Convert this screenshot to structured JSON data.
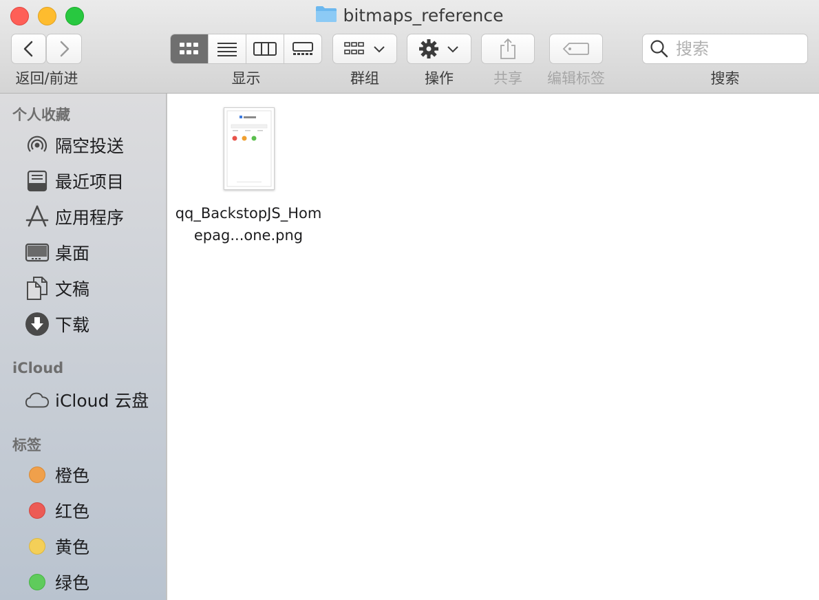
{
  "window": {
    "title": "bitmaps_reference"
  },
  "toolbar": {
    "nav_label": "返回/前进",
    "view_label": "显示",
    "group_label": "群组",
    "action_label": "操作",
    "share_label": "共享",
    "tags_label": "编辑标签",
    "search_label": "搜索",
    "search_placeholder": "搜索"
  },
  "sidebar": {
    "favorites_header": "个人收藏",
    "favorites": [
      {
        "label": "隔空投送",
        "icon": "airdrop-icon"
      },
      {
        "label": "最近项目",
        "icon": "recents-icon"
      },
      {
        "label": "应用程序",
        "icon": "applications-icon"
      },
      {
        "label": "桌面",
        "icon": "desktop-icon"
      },
      {
        "label": "文稿",
        "icon": "documents-icon"
      },
      {
        "label": "下载",
        "icon": "downloads-icon"
      }
    ],
    "icloud_header": "iCloud",
    "icloud": [
      {
        "label": "iCloud 云盘",
        "icon": "cloud-icon"
      }
    ],
    "tags_header": "标签",
    "tags": [
      {
        "label": "橙色",
        "color": "#f0a04b"
      },
      {
        "label": "红色",
        "color": "#ec5b55"
      },
      {
        "label": "黄色",
        "color": "#f4cf58"
      },
      {
        "label": "绿色",
        "color": "#5fcb5c"
      }
    ]
  },
  "files": [
    {
      "name": "qq_BackstopJS_Homepag...one.png"
    }
  ]
}
